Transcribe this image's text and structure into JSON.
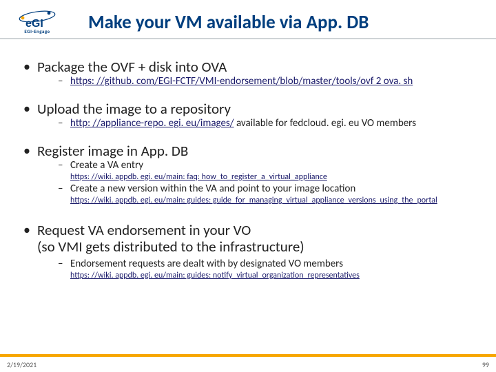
{
  "logo": {
    "text": "eGI",
    "sub": "EGI-Engage"
  },
  "title": "Make your VM available via App. DB",
  "bullets": [
    {
      "text": "Package the OVF + disk into OVA",
      "subs": [
        {
          "link": "https: //github. com/EGI-FCTF/VMI-endorsement/blob/master/tools/ovf 2 ova. sh"
        }
      ]
    },
    {
      "text": "Upload the image to a repository",
      "subs": [
        {
          "link": "http: //appliance-repo. egi. eu/images/",
          "after": " available for fedcloud. egi. eu VO members"
        }
      ]
    },
    {
      "text": "Register image in App. DB",
      "subs": [
        {
          "text": "Create a VA entry",
          "link_below": "https: //wiki. appdb. egi. eu/main: faq: how_to_register_a_virtual_appliance"
        },
        {
          "text": "Create a new version within the VA and point to your image location",
          "link_below": "https: //wiki. appdb. egi. eu/main: guides: guide_for_managing_virtual_appliance_versions_using_the_portal"
        }
      ]
    },
    {
      "text": "Request VA endorsement in your VO\n(so VMI gets distributed to the infrastructure)",
      "subs": [
        {
          "text": "Endorsement requests are dealt with by designated VO members",
          "link_below": "https: //wiki. appdb. egi. eu/main: guides: notify_virtual_organization_representatives"
        }
      ]
    }
  ],
  "footer": {
    "date": "2/19/2021",
    "page": "99"
  }
}
